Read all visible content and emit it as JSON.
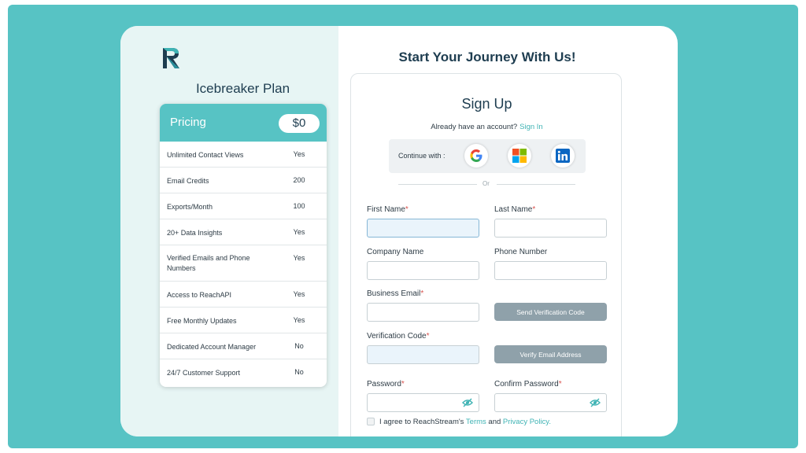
{
  "plan": {
    "title": "Icebreaker Plan",
    "pricing_label": "Pricing",
    "price": "$0",
    "features": [
      {
        "name": "Unlimited Contact Views",
        "value": "Yes"
      },
      {
        "name": "Email Credits",
        "value": "200"
      },
      {
        "name": "Exports/Month",
        "value": "100"
      },
      {
        "name": "20+ Data Insights",
        "value": "Yes"
      },
      {
        "name": "Verified Emails and Phone Numbers",
        "value": "Yes"
      },
      {
        "name": "Access to ReachAPI",
        "value": "Yes"
      },
      {
        "name": "Free Monthly Updates",
        "value": "Yes"
      },
      {
        "name": "Dedicated Account Manager",
        "value": "No"
      },
      {
        "name": "24/7 Customer Support",
        "value": "No"
      }
    ]
  },
  "header": {
    "title": "Start Your Journey With Us!"
  },
  "signup": {
    "title": "Sign Up",
    "have_account": "Already have an account?",
    "sign_in_link": "Sign In",
    "continue_with": "Continue with :",
    "social_icons": [
      "google-icon",
      "microsoft-icon",
      "linkedin-icon"
    ],
    "or_text": "Or"
  },
  "form": {
    "first_name": {
      "label": "First Name",
      "required": "*",
      "value": ""
    },
    "last_name": {
      "label": "Last Name",
      "required": "*",
      "value": ""
    },
    "company_name": {
      "label": "Company Name",
      "value": ""
    },
    "phone_number": {
      "label": "Phone Number",
      "value": ""
    },
    "business_email": {
      "label": "Business Email",
      "required": "*",
      "value": ""
    },
    "send_code_button": "Send Verification Code",
    "verification_code": {
      "label": "Verification Code",
      "required": "*",
      "value": ""
    },
    "verify_button": "Verify Email Address",
    "password": {
      "label": "Password",
      "required": "*",
      "value": ""
    },
    "confirm_password": {
      "label": "Confirm Password",
      "required": "*",
      "value": ""
    },
    "agree": {
      "prefix": "I agree to ReachStream's",
      "terms": "Terms",
      "and": "and",
      "privacy": "Privacy Policy."
    }
  },
  "colors": {
    "accent": "#57c3c4",
    "link": "#3fb3b4",
    "button": "#8fa1aa",
    "navy": "#1e3d50"
  }
}
